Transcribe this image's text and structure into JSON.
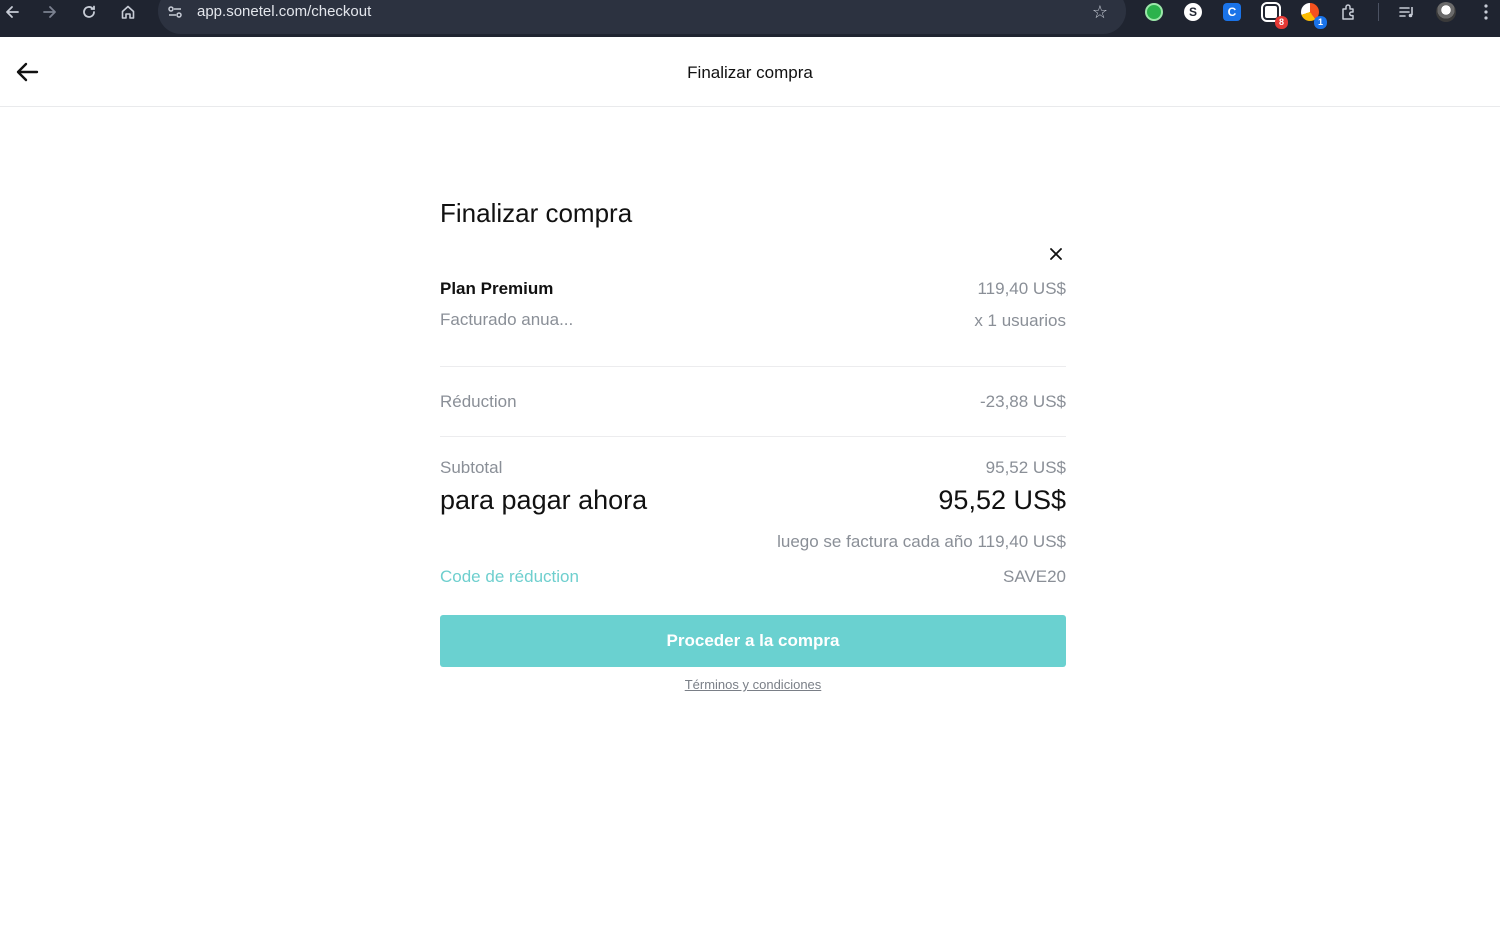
{
  "browser": {
    "url": "app.sonetel.com/checkout",
    "badges": {
      "ext_calendar": "8",
      "ext_colorful": "1"
    },
    "ext_letters": {
      "s": "S",
      "c": "C"
    }
  },
  "header": {
    "title": "Finalizar compra"
  },
  "checkout": {
    "title": "Finalizar compra",
    "plan": {
      "name": "Plan Premium",
      "price": "119,40 US$",
      "billing": "Facturado anua...",
      "quantity": "x 1 usuarios"
    },
    "discount": {
      "label": "Réduction",
      "value": "-23,88 US$"
    },
    "subtotal": {
      "label": "Subtotal",
      "value": "95,52 US$"
    },
    "pay_now": {
      "label": "para pagar ahora",
      "value": "95,52 US$"
    },
    "renewal_note": "luego se factura cada año 119,40 US$",
    "coupon": {
      "label": "Code de réduction",
      "code": "SAVE20"
    },
    "proceed_label": "Proceder a la compra",
    "terms_label": "Términos y condiciones"
  },
  "colors": {
    "accent": "#6ad1d0",
    "link": "#6ecfce",
    "chrome": "#1f2430"
  }
}
